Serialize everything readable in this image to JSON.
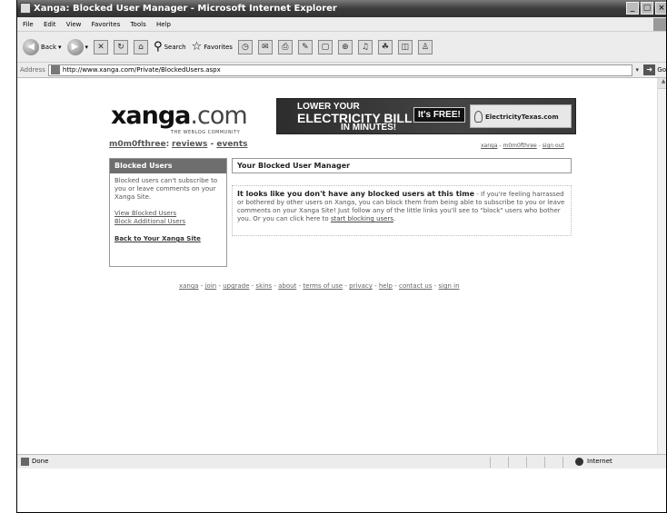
{
  "window": {
    "title": "Xanga: Blocked User Manager - Microsoft Internet Explorer",
    "controls": [
      "_",
      "□",
      "×"
    ]
  },
  "menu": {
    "items": [
      "File",
      "Edit",
      "View",
      "Favorites",
      "Tools",
      "Help"
    ]
  },
  "toolbar": {
    "back_label": "Back",
    "search_label": "Search",
    "favorites_label": "Favorites"
  },
  "address": {
    "label": "Address",
    "url": "http://www.xanga.com/Private/BlockedUsers.aspx",
    "go_label": "Go"
  },
  "page": {
    "logo": {
      "name": "xanga",
      "suffix": ".com",
      "tagline": "THE WEBLOG COMMUNITY"
    },
    "banner": {
      "line1": "LOWER YOUR",
      "line2": "ELECTRICITY BILL",
      "line3": "IN MINUTES!",
      "cta": "It's FREE!",
      "sponsor": "ElectricityTexas.com"
    },
    "userline": {
      "username": "m0m0fthree",
      "sep": ":",
      "reviews": "reviews",
      "dash": " - ",
      "events": "events"
    },
    "toplinks": {
      "xanga": "xanga",
      "user": "m0m0fthree",
      "signout": "sign out",
      "sep": " - "
    },
    "sidebar": {
      "title": "Blocked Users",
      "description": "Blocked users can't subscribe to you or leave comments on your Xanga Site.",
      "view_link": "View Blocked Users",
      "block_link": "Block Additional Users",
      "back_link": "Back to Your Xanga Site"
    },
    "main": {
      "title": "Your Blocked User Manager",
      "notice_bold": "It looks like you don't have any blocked users at this time",
      "notice_text": " - If you're feeling harrassed or bothered by other users on Xanga, you can block them from being able to subscribe to you or leave comments on your Xanga Site! Just follow any of the little links you'll see to \"block\" users who bother you. Or you can click here to ",
      "notice_link": "start blocking users",
      "notice_end": "."
    },
    "footer": {
      "links": [
        "xanga",
        "join",
        "upgrade",
        "skins",
        "about",
        "terms of use",
        "privacy",
        "help",
        "contact us",
        "sign in"
      ],
      "sep": " - "
    }
  },
  "status": {
    "text": "Done",
    "zone": "Internet"
  }
}
